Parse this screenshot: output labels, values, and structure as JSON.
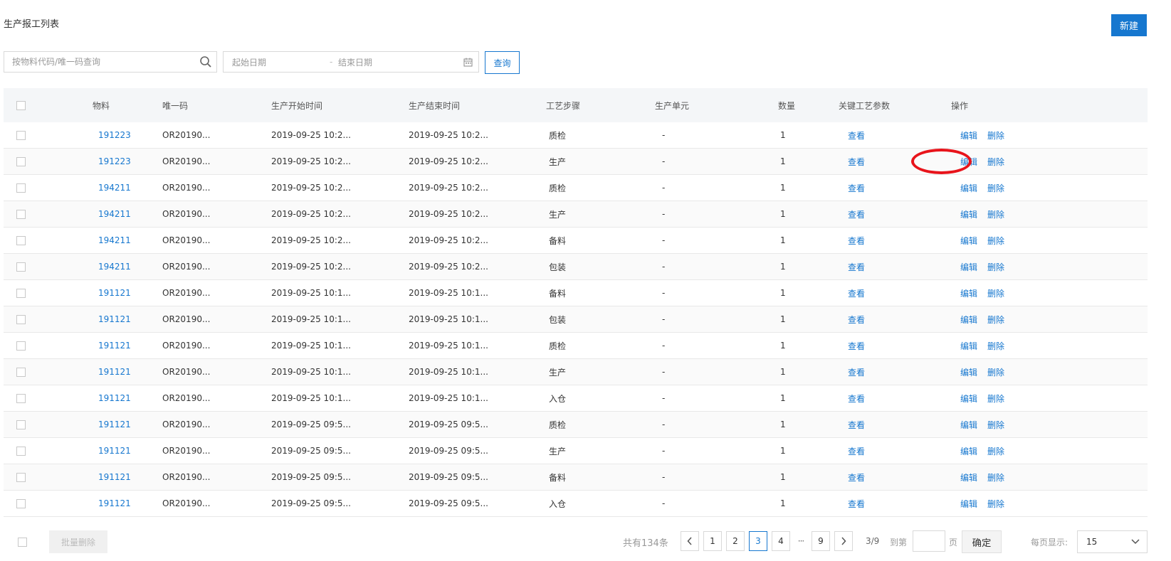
{
  "page": {
    "title": "生产报工列表",
    "new_button": "新建"
  },
  "filters": {
    "search_placeholder": "按物料代码/唯一码查询",
    "date_start_placeholder": "起始日期",
    "date_sep": "-",
    "date_end_placeholder": "结束日期",
    "query_button": "查询"
  },
  "table": {
    "headers": [
      "物料",
      "唯一码",
      "生产开始时间",
      "生产结束时间",
      "工艺步骤",
      "生产单元",
      "数量",
      "关键工艺参数",
      "操作"
    ],
    "view_label": "查看",
    "edit_label": "编辑",
    "delete_label": "删除",
    "rows": [
      {
        "material": "191223",
        "uid": "OR20190...",
        "start": "2019-09-25 10:2...",
        "end": "2019-09-25 10:2...",
        "step": "质检",
        "unit": "-",
        "qty": "1"
      },
      {
        "material": "191223",
        "uid": "OR20190...",
        "start": "2019-09-25 10:2...",
        "end": "2019-09-25 10:2...",
        "step": "生产",
        "unit": "-",
        "qty": "1"
      },
      {
        "material": "194211",
        "uid": "OR20190...",
        "start": "2019-09-25 10:2...",
        "end": "2019-09-25 10:2...",
        "step": "质检",
        "unit": "-",
        "qty": "1"
      },
      {
        "material": "194211",
        "uid": "OR20190...",
        "start": "2019-09-25 10:2...",
        "end": "2019-09-25 10:2...",
        "step": "生产",
        "unit": "-",
        "qty": "1"
      },
      {
        "material": "194211",
        "uid": "OR20190...",
        "start": "2019-09-25 10:2...",
        "end": "2019-09-25 10:2...",
        "step": "备料",
        "unit": "-",
        "qty": "1"
      },
      {
        "material": "194211",
        "uid": "OR20190...",
        "start": "2019-09-25 10:2...",
        "end": "2019-09-25 10:2...",
        "step": "包装",
        "unit": "-",
        "qty": "1"
      },
      {
        "material": "191121",
        "uid": "OR20190...",
        "start": "2019-09-25 10:1...",
        "end": "2019-09-25 10:1...",
        "step": "备料",
        "unit": "-",
        "qty": "1"
      },
      {
        "material": "191121",
        "uid": "OR20190...",
        "start": "2019-09-25 10:1...",
        "end": "2019-09-25 10:1...",
        "step": "包装",
        "unit": "-",
        "qty": "1"
      },
      {
        "material": "191121",
        "uid": "OR20190...",
        "start": "2019-09-25 10:1...",
        "end": "2019-09-25 10:1...",
        "step": "质检",
        "unit": "-",
        "qty": "1"
      },
      {
        "material": "191121",
        "uid": "OR20190...",
        "start": "2019-09-25 10:1...",
        "end": "2019-09-25 10:1...",
        "step": "生产",
        "unit": "-",
        "qty": "1"
      },
      {
        "material": "191121",
        "uid": "OR20190...",
        "start": "2019-09-25 10:1...",
        "end": "2019-09-25 10:1...",
        "step": "入仓",
        "unit": "-",
        "qty": "1"
      },
      {
        "material": "191121",
        "uid": "OR20190...",
        "start": "2019-09-25 09:5...",
        "end": "2019-09-25 09:5...",
        "step": "质检",
        "unit": "-",
        "qty": "1"
      },
      {
        "material": "191121",
        "uid": "OR20190...",
        "start": "2019-09-25 09:5...",
        "end": "2019-09-25 09:5...",
        "step": "生产",
        "unit": "-",
        "qty": "1"
      },
      {
        "material": "191121",
        "uid": "OR20190...",
        "start": "2019-09-25 09:5...",
        "end": "2019-09-25 09:5...",
        "step": "备料",
        "unit": "-",
        "qty": "1"
      },
      {
        "material": "191121",
        "uid": "OR20190...",
        "start": "2019-09-25 09:5...",
        "end": "2019-09-25 09:5...",
        "step": "入仓",
        "unit": "-",
        "qty": "1"
      }
    ]
  },
  "footer": {
    "batch_delete": "批量删除",
    "total": "共有134条",
    "pages": [
      "1",
      "2",
      "3",
      "4"
    ],
    "ellipsis": "···",
    "last_page": "9",
    "current_page": "3",
    "page_info": "3/9",
    "goto_label": "到第",
    "page_label": "页",
    "confirm": "确定",
    "per_page_label": "每页显示:",
    "per_page_value": "15"
  },
  "colors": {
    "accent": "#1677cf",
    "highlight": "#e8141b"
  }
}
